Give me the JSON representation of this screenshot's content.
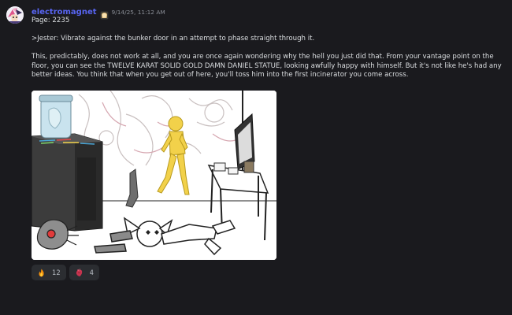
{
  "message": {
    "author": "electromagnet",
    "timestamp": "9/14/25, 11:12 AM",
    "page_label": "Page: 2235",
    "command": ">Jester: Vibrate against the bunker door in an attempt to phase straight through it.",
    "body": "This, predictably, does not work at all, and you are once again wondering why the hell you just did that. From your vantage point on the floor, you can see the TWELVE KARAT SOLID GOLD DAMN DANIEL STATUE, looking awfully happy with himself. But it's not like he's had any better ideas. You think that when you get out of here, you'll toss him into the first incinerator you come across.",
    "badge_icon": "bread-icon",
    "accent_color": "#5865f2"
  },
  "attachment": {
    "type": "comic-panel-image"
  },
  "reactions": [
    {
      "icon": "fire-icon",
      "count": "12"
    },
    {
      "icon": "anatomical-heart-icon",
      "count": "4"
    }
  ]
}
